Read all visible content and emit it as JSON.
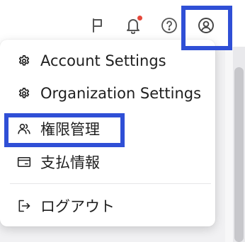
{
  "topbar": {
    "icons": [
      "flag-icon",
      "bell-icon",
      "help-icon",
      "user-circle-icon"
    ],
    "notification_dot_color": "#e5483b"
  },
  "user_menu": {
    "items": [
      {
        "label": "Account Settings",
        "icon": "gear-icon"
      },
      {
        "label": "Organization Settings",
        "icon": "gear-icon"
      },
      {
        "label": "権限管理",
        "icon": "users-icon"
      },
      {
        "label": "支払情報",
        "icon": "credit-card-icon"
      }
    ],
    "logout": {
      "label": "ログアウト",
      "icon": "logout-icon"
    }
  },
  "highlight_color": "#2f4fd6"
}
